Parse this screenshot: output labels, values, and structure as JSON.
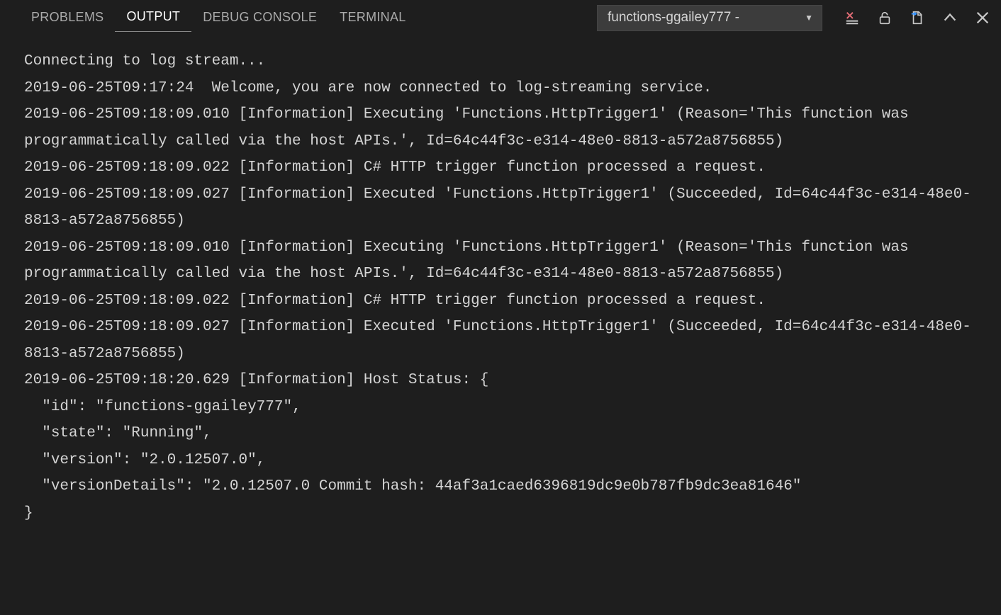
{
  "tabs": {
    "problems": "PROBLEMS",
    "output": "OUTPUT",
    "debug_console": "DEBUG CONSOLE",
    "terminal": "TERMINAL",
    "active": "output"
  },
  "dropdown": {
    "selected": "functions-ggailey777 -"
  },
  "icons": {
    "clear": "clear-output-icon",
    "lock": "scroll-lock-icon",
    "open": "open-log-icon",
    "up": "collapse-up-icon",
    "close": "close-icon"
  },
  "log_lines": [
    "Connecting to log stream...",
    "2019-06-25T09:17:24  Welcome, you are now connected to log-streaming service.",
    "2019-06-25T09:18:09.010 [Information] Executing 'Functions.HttpTrigger1' (Reason='This function was programmatically called via the host APIs.', Id=64c44f3c-e314-48e0-8813-a572a8756855)",
    "2019-06-25T09:18:09.022 [Information] C# HTTP trigger function processed a request.",
    "2019-06-25T09:18:09.027 [Information] Executed 'Functions.HttpTrigger1' (Succeeded, Id=64c44f3c-e314-48e0-8813-a572a8756855)",
    "2019-06-25T09:18:09.010 [Information] Executing 'Functions.HttpTrigger1' (Reason='This function was programmatically called via the host APIs.', Id=64c44f3c-e314-48e0-8813-a572a8756855)",
    "2019-06-25T09:18:09.022 [Information] C# HTTP trigger function processed a request.",
    "2019-06-25T09:18:09.027 [Information] Executed 'Functions.HttpTrigger1' (Succeeded, Id=64c44f3c-e314-48e0-8813-a572a8756855)",
    "2019-06-25T09:18:20.629 [Information] Host Status: {",
    "  \"id\": \"functions-ggailey777\",",
    "  \"state\": \"Running\",",
    "  \"version\": \"2.0.12507.0\",",
    "  \"versionDetails\": \"2.0.12507.0 Commit hash: 44af3a1caed6396819dc9e0b787fb9dc3ea81646\"",
    "}"
  ]
}
